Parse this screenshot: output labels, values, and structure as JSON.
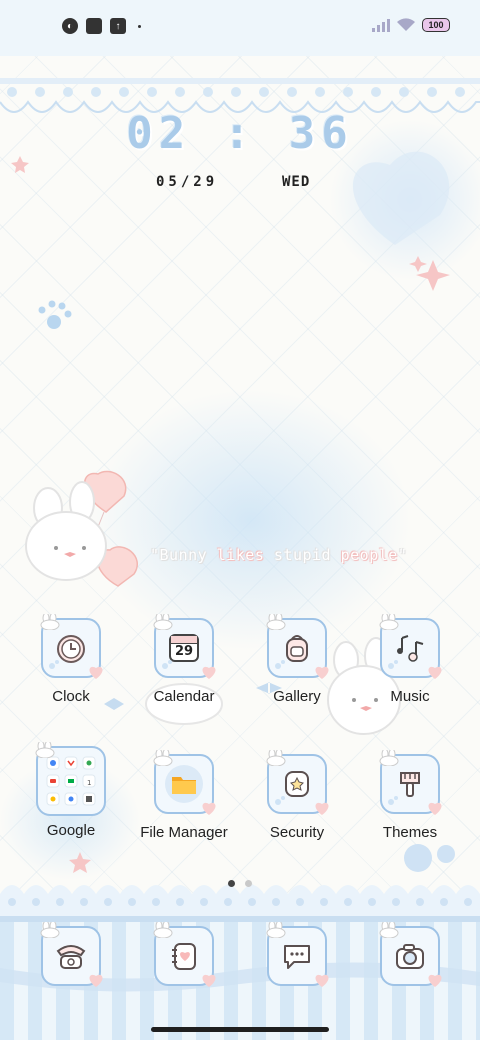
{
  "status_bar": {
    "left_icons": [
      "app-notification-icon",
      "square-app-icon",
      "upload-icon"
    ],
    "battery": "100",
    "colors": {
      "background": "#eef6fb",
      "battery_fill": "#e9c6ea"
    }
  },
  "lock_clock": {
    "time": "02 : 36",
    "date": "05/29",
    "weekday": "WED",
    "color": "#aacbe9"
  },
  "quote": {
    "prefix": "\"Bunny ",
    "word1": "likes",
    "middle": " stupid ",
    "word2": "people",
    "suffix": "\""
  },
  "apps": [
    {
      "label": "Clock",
      "icon": "clock-icon"
    },
    {
      "label": "Calendar",
      "icon": "calendar-icon",
      "badge": "29"
    },
    {
      "label": "Gallery",
      "icon": "gallery-icon"
    },
    {
      "label": "Music",
      "icon": "music-icon"
    },
    {
      "label": "Google",
      "icon": "google-folder-icon"
    },
    {
      "label": "File Manager",
      "icon": "folder-icon"
    },
    {
      "label": "Security",
      "icon": "security-icon"
    },
    {
      "label": "Themes",
      "icon": "themes-icon"
    }
  ],
  "dock": [
    {
      "icon": "phone-icon"
    },
    {
      "icon": "contacts-icon"
    },
    {
      "icon": "messages-icon"
    },
    {
      "icon": "camera-icon"
    }
  ],
  "pager": {
    "pages": 2,
    "current": 1
  },
  "theme_colors": {
    "tile_border": "#9fc3e6",
    "tile_bg": "#f2f8fd",
    "accent_pink": "#f6c9c9"
  }
}
